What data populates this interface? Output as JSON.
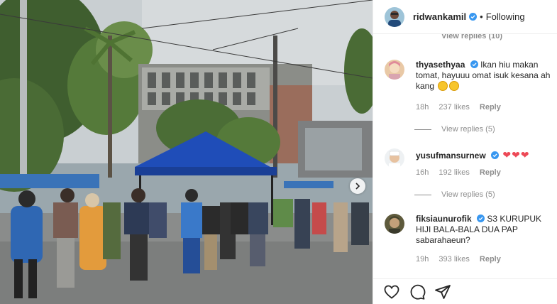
{
  "post": {
    "username": "ridwankamil",
    "follow_status": "Following",
    "separator": "•"
  },
  "comments": {
    "partial_view_replies": "View replies (10)",
    "items": [
      {
        "username": "thyasethyaa",
        "text": "Ikan hiu makan tomat, hayuuu omat isuk kesana ah kang",
        "time": "18h",
        "likes": "237 likes",
        "reply": "Reply",
        "view_replies": "View replies (5)",
        "emoji": "smile-emoji"
      },
      {
        "username": "yusufmansurnew",
        "text": "",
        "time": "16h",
        "likes": "192 likes",
        "reply": "Reply",
        "view_replies": "View replies (5)",
        "hearts": "❤❤❤"
      },
      {
        "username": "fiksiaunurofik",
        "text": "S3 KURUPUK HIJI BALA-BALA DUA PAP sabarahaeun?",
        "time": "19h",
        "likes": "393 likes",
        "reply": "Reply"
      }
    ]
  },
  "icons": {
    "like": "heart-icon",
    "comment": "comment-icon",
    "share": "share-icon",
    "verified": "verified-badge-icon",
    "next": "chevron-right-icon"
  },
  "colors": {
    "verified": "#3897f0",
    "tent": "#1f4db8",
    "muted": "#8e8e8e",
    "heart": "#ed4956"
  }
}
